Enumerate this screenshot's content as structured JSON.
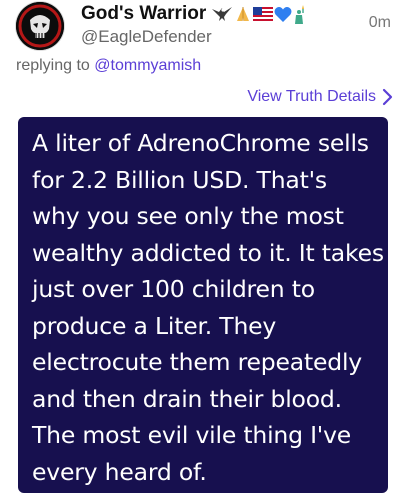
{
  "post": {
    "author": {
      "display_name": "God's Warrior",
      "name_emojis": [
        "eagle-icon",
        "praying-hands-icon",
        "us-flag-icon",
        "blue-heart-icon",
        "statue-of-liberty-icon"
      ],
      "handle": "@EagleDefender",
      "avatar_icon": "punisher-skull-icon"
    },
    "timestamp": "0m",
    "replying_prefix": "replying to",
    "replying_to": "@tommyamish",
    "view_details_label": "View Truth Details",
    "image": {
      "background": "#17104f",
      "lines": [
        "A liter of AdrenoChrome sells",
        "for 2.2 Billion USD. That's",
        "why you see only the most",
        "wealthy addicted to it. It takes",
        "just over 100 children to",
        "produce a Liter. They",
        "electrocute them repeatedly",
        "and then drain their blood.",
        "The most evil vile thing I've",
        "every heard of."
      ]
    }
  },
  "colors": {
    "accent": "#5b3fd6",
    "muted": "#666666"
  }
}
